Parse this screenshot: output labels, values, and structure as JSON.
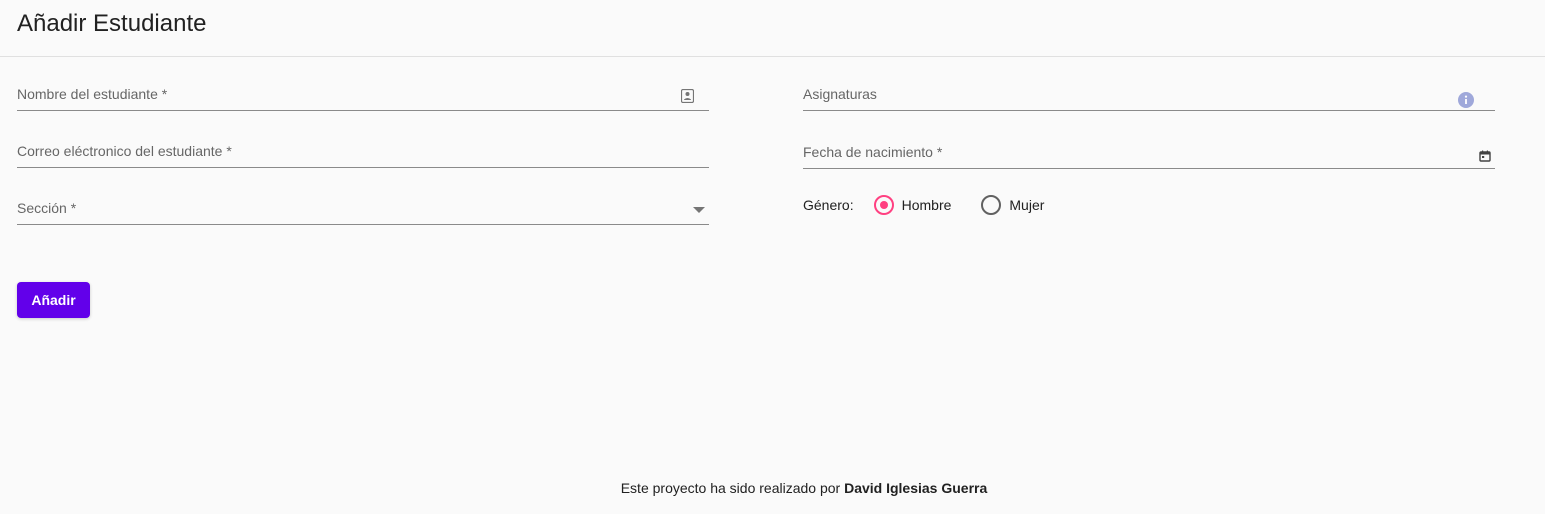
{
  "page": {
    "title": "Añadir Estudiante"
  },
  "form": {
    "nombre": {
      "label": "Nombre del estudiante *",
      "value": "",
      "icon": "contact-card-icon"
    },
    "correo": {
      "label": "Correo eléctronico del estudiante *",
      "value": ""
    },
    "seccion": {
      "label": "Sección *",
      "value": "",
      "icon": "dropdown-arrow-icon"
    },
    "asignaturas": {
      "label": "Asignaturas",
      "value": "",
      "icon": "info-icon"
    },
    "fecha": {
      "label": "Fecha de nacimiento *",
      "value": "",
      "icon": "calendar-icon"
    },
    "genero": {
      "label": "Género:",
      "options": [
        {
          "label": "Hombre",
          "selected": true
        },
        {
          "label": "Mujer",
          "selected": false
        }
      ]
    },
    "submit_label": "Añadir"
  },
  "footer": {
    "prefix": "Este proyecto ha sido realizado por",
    "author": "David Iglesias Guerra"
  },
  "colors": {
    "primary": "#6200ea",
    "accent": "#ff4081",
    "info_icon": "#9fa8da"
  }
}
